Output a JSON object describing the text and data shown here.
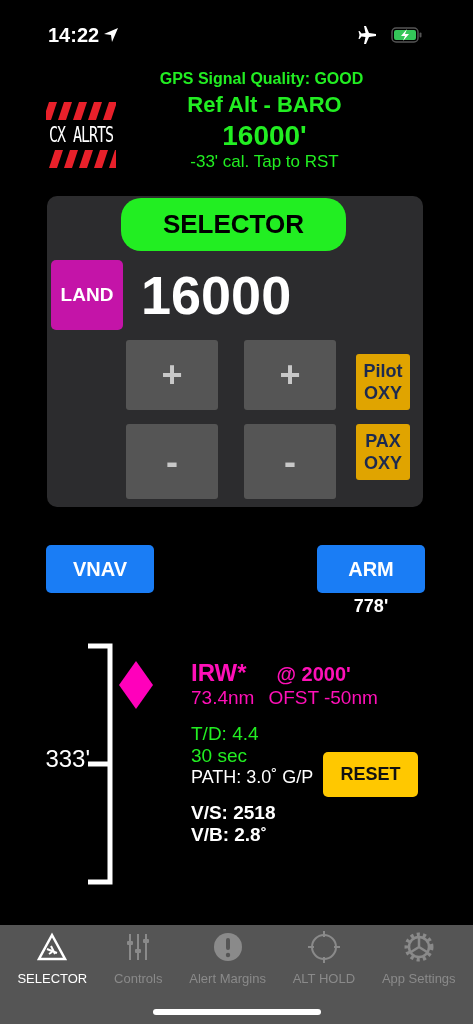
{
  "status_bar": {
    "time": "14:22"
  },
  "header": {
    "gps_quality": "GPS Signal Quality: GOOD",
    "ref_alt": "Ref Alt - BARO",
    "altitude": "16000'",
    "calibration": "-33' cal. Tap to RST"
  },
  "logo": {
    "text": "CX ALRTS"
  },
  "selector": {
    "title": "SELECTOR",
    "mode": "LAND",
    "value": "16000",
    "increment_buttons": [
      "+",
      "+"
    ],
    "decrement_buttons": [
      "-",
      "-"
    ],
    "oxy_buttons": [
      "Pilot OXY",
      "PAX OXY"
    ]
  },
  "vnav": {
    "vnav_button": "VNAV",
    "arm_button": "ARM",
    "arm_reading": "778'"
  },
  "profile": {
    "deviation": "333'",
    "waypoint": "IRW*",
    "crossing_alt": "@ 2000'",
    "distance": "73.4nm",
    "offset": "OFST -50nm",
    "top_of_descent": "T/D: 4.4",
    "time_to_descent": "30 sec",
    "path": "PATH: 3.0˚ G/P",
    "vertical_speed": "V/S: 2518",
    "vertical_bearing": "V/B: 2.8˚",
    "reset_button": "RESET"
  },
  "tab_bar": {
    "tabs": [
      {
        "label": "SELECTOR",
        "selected": true
      },
      {
        "label": "Controls",
        "selected": false
      },
      {
        "label": "Alert Margins",
        "selected": false
      },
      {
        "label": "ALT HOLD",
        "selected": false
      },
      {
        "label": "App Settings",
        "selected": false
      }
    ]
  }
}
